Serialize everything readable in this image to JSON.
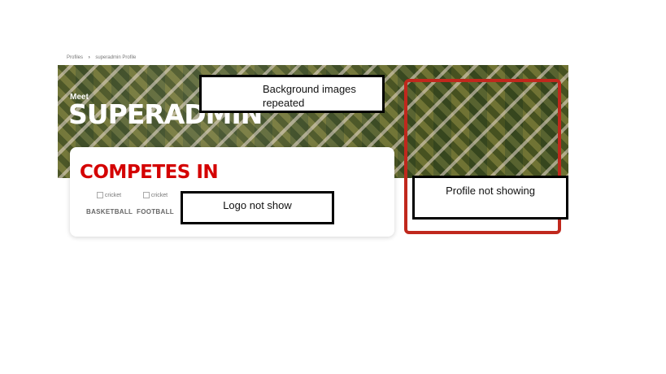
{
  "breadcrumb": {
    "items": [
      "Profiles",
      "superadmin Profile"
    ]
  },
  "hero": {
    "greeting": "Meet",
    "name": "SUPERADMIN"
  },
  "competes": {
    "title": "COMPETES IN",
    "sports": [
      {
        "alt": "cricket",
        "label": "BASKETBALL"
      },
      {
        "alt": "cricket",
        "label": "FOOTBALL"
      }
    ]
  },
  "annotations": {
    "background": "Background images repeated",
    "logo": "Logo not show",
    "profile": "Profile not showing"
  },
  "colors": {
    "accent_red": "#d40000",
    "frame_red": "#c0281d"
  }
}
